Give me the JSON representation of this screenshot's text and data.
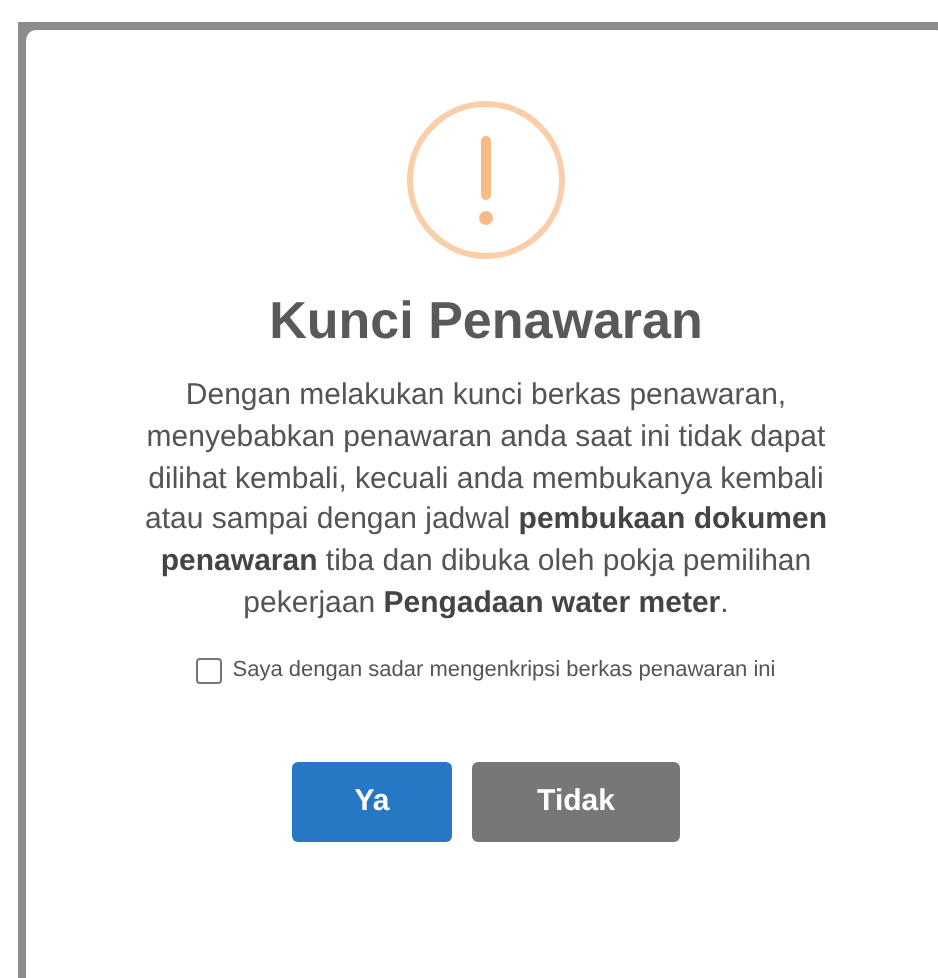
{
  "dialog": {
    "title": "Kunci Penawaran",
    "message": "Dengan melakukan kunci berkas penawaran, menyebabkan penawaran anda saat ini tidak dapat dilihat kembali, kecuali anda membukanya kembali atau sampai dengan jadwal **pembukaan dokumen penawaran** tiba dan dibuka oleh pokja pemilihan pekerjaan **Pengadaan water meter**.",
    "confirm": {
      "label": "Saya dengan sadar mengenkripsi berkas penawaran ini",
      "checked": false
    },
    "buttons": [
      {
        "label": "Ya",
        "kind": "primary"
      },
      {
        "label": "Tidak",
        "kind": "secondary"
      }
    ]
  }
}
